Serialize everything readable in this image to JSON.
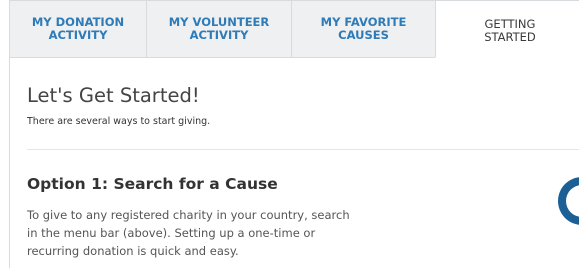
{
  "tabs": [
    {
      "line1": "MY DONATION",
      "line2": "ACTIVITY",
      "active": false
    },
    {
      "line1": "MY VOLUNTEER",
      "line2": "ACTIVITY",
      "active": false
    },
    {
      "line1": "MY FAVORITE",
      "line2": "CAUSES",
      "active": false
    },
    {
      "line1": "GETTING",
      "line2": "STARTED",
      "active": true
    }
  ],
  "main": {
    "title": "Let's Get Started!",
    "subtitle": "There are several ways to start giving.",
    "option1": {
      "title": "Option 1: Search for a Cause",
      "body_lines": [
        "To give to any registered charity in your country, search",
        "in the menu bar (above). Setting up a one-time or",
        "recurring donation is quick and easy."
      ]
    }
  },
  "colors": {
    "tab_link": "#2e7bb8",
    "tab_bg": "#eef0f1",
    "border": "#d8dbdd",
    "spinner": "#1c5f95"
  },
  "icons": {
    "spinner": "loading-spinner-icon"
  }
}
